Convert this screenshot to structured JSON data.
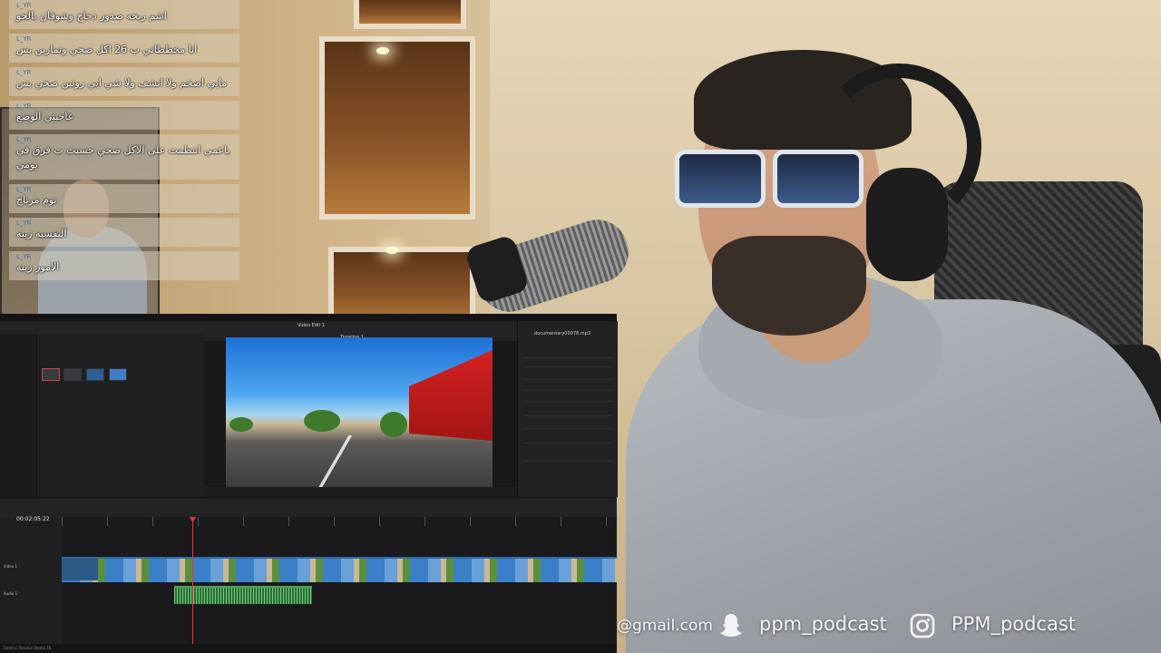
{
  "chat": {
    "messages": [
      {
        "user": "L_YR",
        "text": "اشم ريحه صدور دجاج وشوفان بالجو"
      },
      {
        "user": "L_YR",
        "text": "انا مخططاتي ب 26 اكل صحي وتمارين بس"
      },
      {
        "user": "L_YR",
        "text": "مابي اضخم ولا انشف ولا شي ابي روتين صحي بس"
      },
      {
        "user": "L_YR",
        "text": "عاجبني الوضع"
      },
      {
        "user": "L_YR",
        "text": "ياعمي انتظمت على الاكل صحي حسيت ب فرق في يومي"
      },
      {
        "user": "L_YR",
        "text": "نوم مرتاح"
      },
      {
        "user": "L_YR",
        "text": "النفسيه زينه"
      },
      {
        "user": "L_YR",
        "text": "الامور زينه"
      }
    ]
  },
  "editor": {
    "window_title": "Video Edit 1",
    "viewer_label": "Timeline 1",
    "timecode": "00:02:05:22",
    "inspector_file": "documentary00078.mp3",
    "status_app": "DaVinci Resolve Studio 18",
    "track_video": "Video 1",
    "track_audio": "Audio 1"
  },
  "social": {
    "email": "@gmail.com",
    "snapchat": "ppm_podcast",
    "instagram": "PPM_podcast",
    "snap_icon": "snapchat-ghost-icon",
    "insta_icon": "instagram-icon"
  }
}
